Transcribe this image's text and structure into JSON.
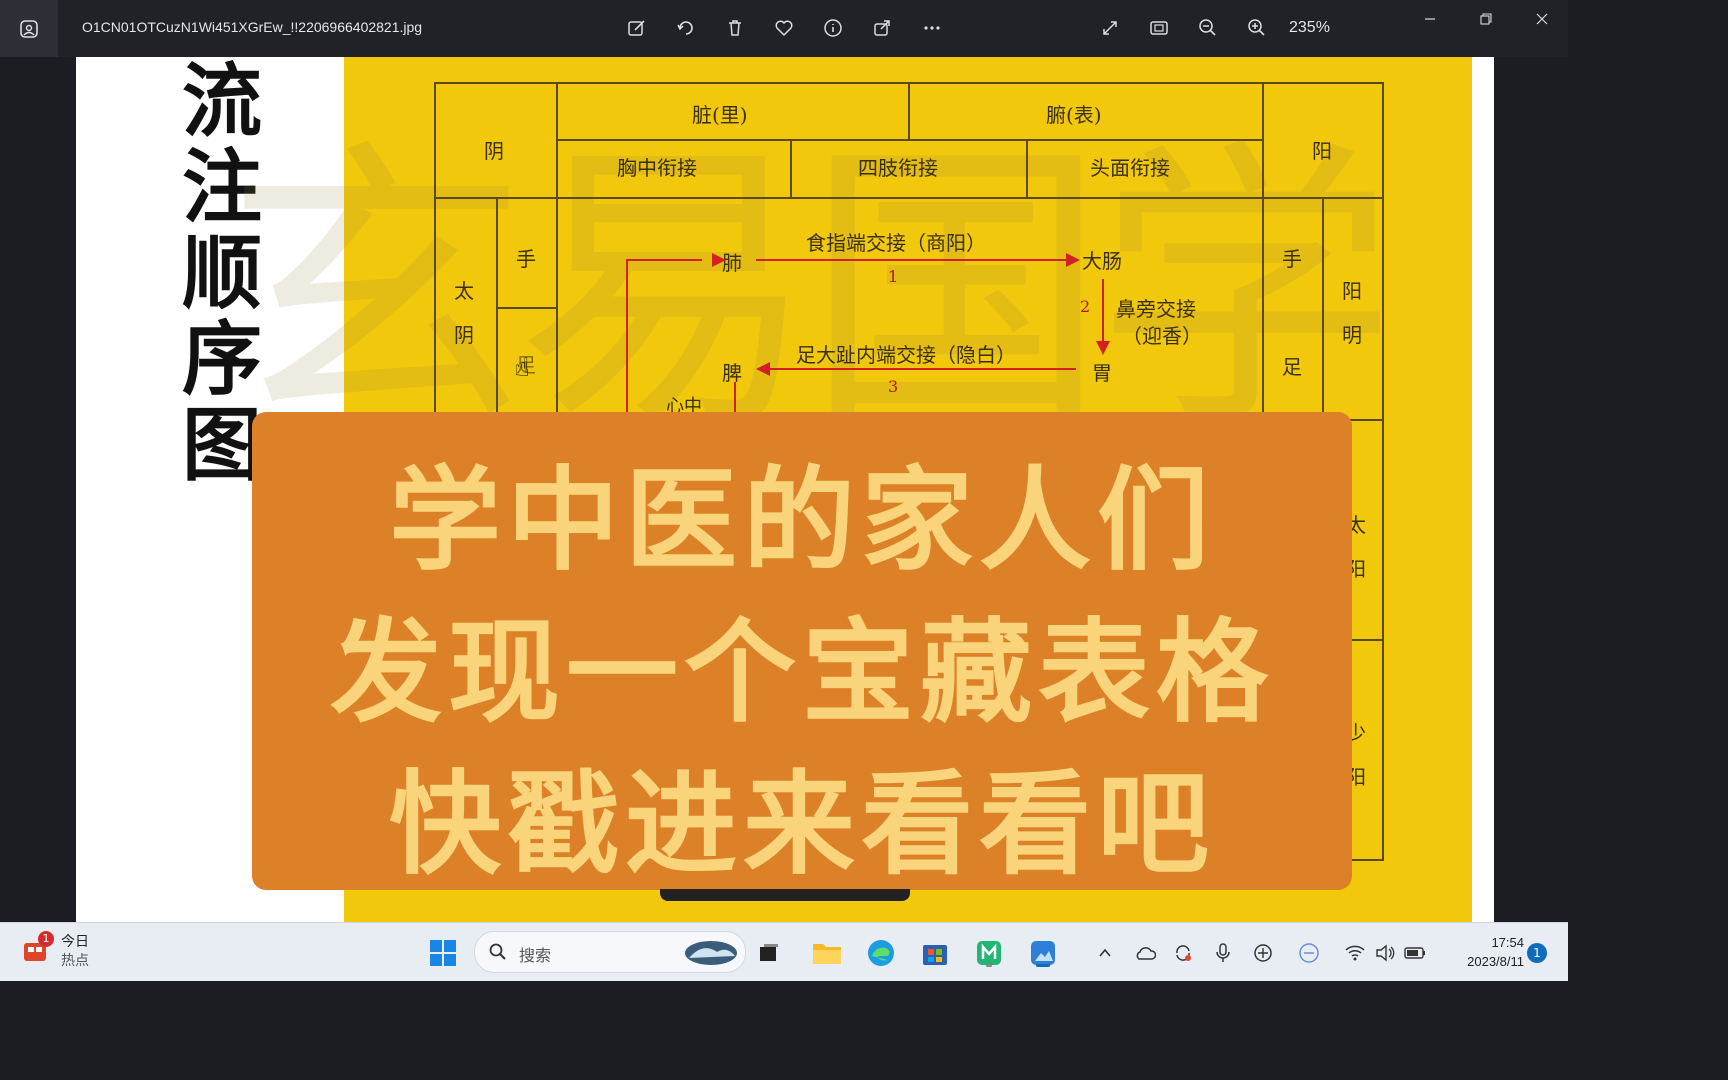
{
  "titlebar": {
    "filename": "O1CN01OTCuzN1Wi451XGrEw_!!2206966402821.jpg",
    "zoom": "235%",
    "icons": [
      "edit-icon",
      "rotate-icon",
      "delete-icon",
      "favorite-icon",
      "info-icon",
      "share-icon",
      "more-icon",
      "fullscreen-icon",
      "fit-icon",
      "zoom-out-icon",
      "zoom-in-icon"
    ]
  },
  "image": {
    "vertical_title": [
      "流",
      "注",
      "顺",
      "序",
      "图"
    ],
    "watermark": "玄易国学",
    "table": {
      "yin": "阴",
      "yang": "阳",
      "zang": "脏(里)",
      "fu": "腑(表)",
      "chest": "胸中衔接",
      "limbs": "四肢衔接",
      "head": "头面衔接",
      "tai": "太",
      "yin2": "阴",
      "shou_left": "手",
      "zu_left": "足",
      "shou_right": "手",
      "zu_right": "足",
      "yang_ming_1": "阳",
      "yang_ming_2": "明",
      "tai_yang_1": "太",
      "tai_yang_2": "阳",
      "shao_yang_1": "少",
      "shao_yang_2": "阳",
      "lung": "肺",
      "large_intestine": "大肠",
      "stomach": "胃",
      "spleen": "脾",
      "heart_center": "心中",
      "label_1": "食指端交接（商阳）",
      "label_2": "鼻旁交接",
      "label_2b": "（迎香）",
      "label_3": "足大趾内端交接（隐白）",
      "num_1": "1",
      "num_2": "2",
      "num_3": "3"
    }
  },
  "overlay": {
    "line1": "学中医的家人们",
    "line2": "发现一个宝藏表格",
    "line3": "快戳进来看看吧"
  },
  "taskbar": {
    "weather_line1": "今日",
    "weather_line2": "热点",
    "weather_badge": "1",
    "search_placeholder": "搜索",
    "time": "17:54",
    "date": "2023/8/11",
    "notifications": "1"
  }
}
